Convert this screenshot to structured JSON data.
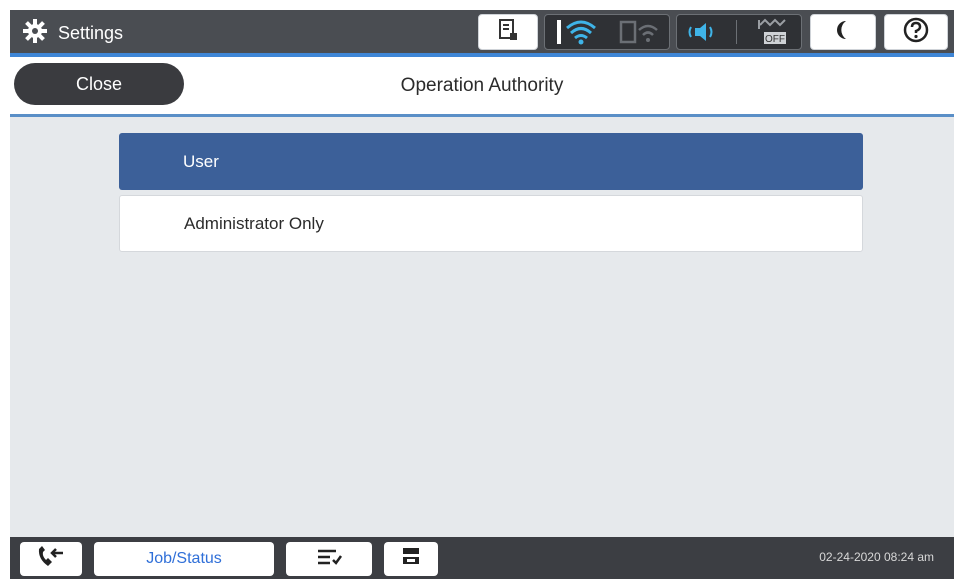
{
  "topbar": {
    "title": "Settings",
    "settings_icon": "gear-icon",
    "status_icons": [
      "document-status-icon",
      "wifi-icon",
      "wifi-direct-icon",
      "sound-icon",
      "signal-off-icon",
      "sleep-icon",
      "help-icon"
    ],
    "off_label": "OFF"
  },
  "header": {
    "close_label": "Close",
    "title": "Operation Authority"
  },
  "options": [
    {
      "label": "User",
      "selected": true
    },
    {
      "label": "Administrator Only",
      "selected": false
    }
  ],
  "bottombar": {
    "job_status_label": "Job/Status",
    "datetime": "02-24-2020 08:24 am"
  },
  "colors": {
    "selected": "#3c6099",
    "accent": "#3f86d6",
    "link": "#2f6fd8"
  }
}
